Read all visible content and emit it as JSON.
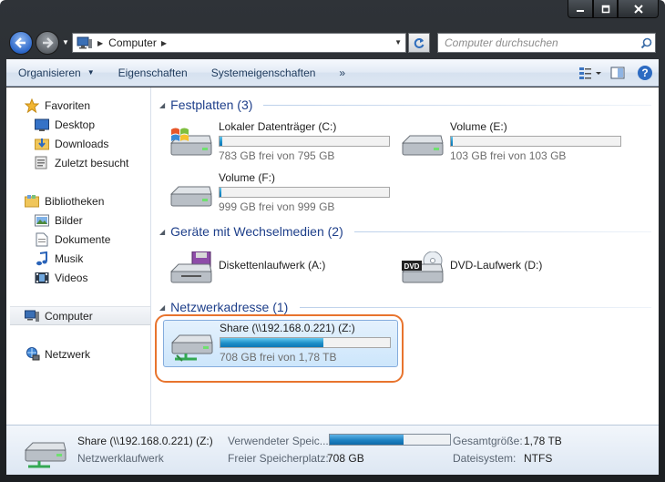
{
  "address": {
    "location": "Computer"
  },
  "search": {
    "placeholder": "Computer durchsuchen"
  },
  "toolbar": {
    "organize": "Organisieren",
    "properties": "Eigenschaften",
    "system_properties": "Systemeigenschaften",
    "more": "»"
  },
  "sidebar": {
    "favorites": "Favoriten",
    "desktop": "Desktop",
    "downloads": "Downloads",
    "recent": "Zuletzt besucht",
    "libraries": "Bibliotheken",
    "pictures": "Bilder",
    "documents": "Dokumente",
    "music": "Musik",
    "videos": "Videos",
    "computer": "Computer",
    "network": "Netzwerk"
  },
  "groups": {
    "hard_drives": "Festplatten (3)",
    "removable": "Geräte mit Wechselmedien (2)",
    "network": "Netzwerkadresse (1)"
  },
  "drives": [
    {
      "name": "Lokaler Datenträger (C:)",
      "free": "783 GB frei von 795 GB",
      "used_fraction": 0.015
    },
    {
      "name": "Volume (E:)",
      "free": "103 GB frei von 103 GB",
      "used_fraction": 0.005
    },
    {
      "name": "Volume (F:)",
      "free": "999 GB frei von 999 GB",
      "used_fraction": 0.005
    }
  ],
  "devices": [
    {
      "name": "Diskettenlaufwerk (A:)"
    },
    {
      "name": "DVD-Laufwerk (D:)"
    }
  ],
  "network_drive": {
    "name": "Share (\\\\192.168.0.221) (Z:)",
    "free": "708 GB frei von 1,78 TB",
    "used_fraction": 0.61
  },
  "details": {
    "name": "Share (\\\\192.168.0.221) (Z:)",
    "type": "Netzwerklaufwerk",
    "used_label": "Verwendeter Speic...",
    "free_label": "Freier Speicherplatz:",
    "free_value": "708 GB",
    "total_label": "Gesamtgröße:",
    "total_value": "1,78 TB",
    "fs_label": "Dateisystem:",
    "fs_value": "NTFS",
    "used_fraction": 0.61
  },
  "colors": {
    "accent": "#e8742e",
    "group_header": "#1e3f8a",
    "bar_fill": "#1f8fc8"
  }
}
